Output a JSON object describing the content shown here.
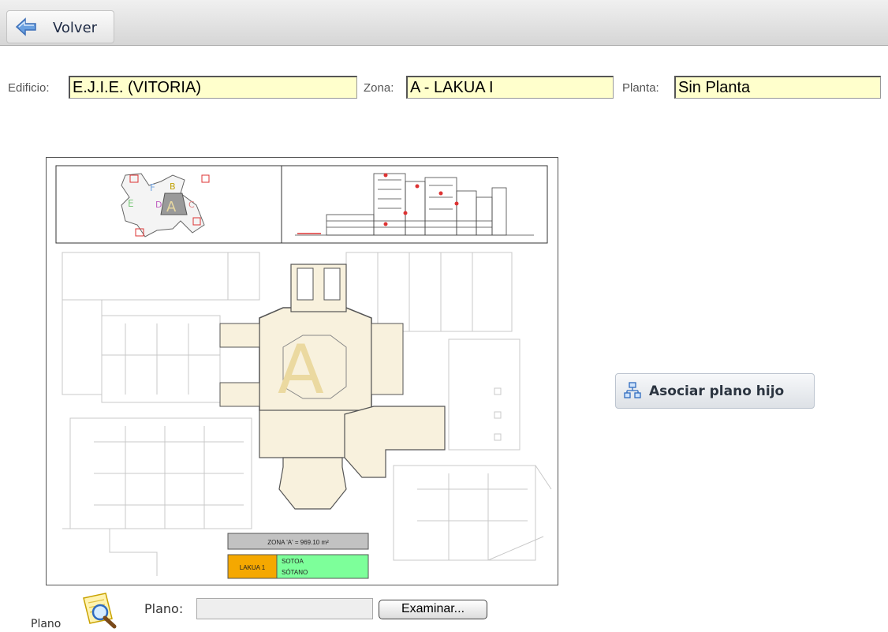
{
  "toolbar": {
    "back_label": "Volver",
    "back_icon": "back-arrow-icon"
  },
  "filters": {
    "building_label": "Edificio:",
    "building_value": "E.J.I.E. (VITORIA)",
    "zone_label": "Zona:",
    "zone_value": "A - LAKUA I",
    "floor_label": "Planta:",
    "floor_value": "Sin Planta",
    "field_bg_color": "#ffffcc"
  },
  "plan": {
    "zone_letter": "A",
    "zone_area_text": "ZONA 'A' = 969.10 m²",
    "legend_left": "LAKUA 1",
    "legend_right_line1": "SOTOA",
    "legend_right_line2": "SÓTANO",
    "legend_left_color": "#f5a800",
    "legend_right_color": "#7dff9a",
    "minimap_labels": [
      "E",
      "F",
      "B",
      "A",
      "D",
      "C"
    ]
  },
  "actions": {
    "associate_label": "Asociar plano hijo",
    "associate_icon": "hierarchy-icon"
  },
  "upload": {
    "caption": "Plano",
    "icon": "magnifier-document-icon",
    "field_label": "Plano:",
    "field_value": "",
    "browse_label": "Examinar..."
  }
}
